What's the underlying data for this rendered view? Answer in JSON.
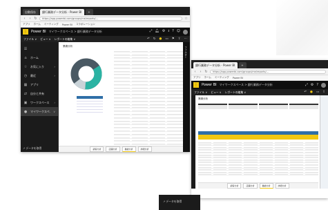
{
  "window1": {
    "tabs": [
      "自動保存",
      "銀行業務データ分析 - Power BI",
      "+"
    ],
    "url": "https://app.powerbi.com/groups/me/reports/...",
    "bookmarks": [
      "アプリ",
      "ホーム",
      "ミーティング",
      "Power BI",
      "コラボレーション"
    ],
    "app_name": "Power BI",
    "breadcrumb": "マイワークスペース > 銀行業務データ分析",
    "menu": [
      "ファイル ∨",
      "ビュー ∨",
      "レポートの編集 ∨"
    ],
    "sidebar": [
      {
        "icon": "☰",
        "label": "",
        "arrow": ""
      },
      {
        "icon": "⌂",
        "label": "ホーム",
        "arrow": ""
      },
      {
        "icon": "☆",
        "label": "お気に入り",
        "arrow": "›"
      },
      {
        "icon": "◷",
        "label": "最近",
        "arrow": "›"
      },
      {
        "icon": "▦",
        "label": "アプリ",
        "arrow": ""
      },
      {
        "icon": "⇄",
        "label": "自分と共有",
        "arrow": ""
      },
      {
        "icon": "▣",
        "label": "ワークスペース",
        "arrow": "›"
      },
      {
        "icon": "●",
        "label": "マイワークスペ...",
        "arrow": "∨"
      }
    ],
    "sidebar_footer": "↗ データを取得",
    "report_title": "業績分析",
    "filters_label": "フィルター",
    "pages": [
      "顧客分析",
      "店舗分析",
      "業績分析",
      "詳細分析"
    ]
  },
  "window2": {
    "tabs": [
      "銀行業務データ分析 - Power BI",
      "+"
    ],
    "url": "https://app.powerbi.com/groups/me/reports/...",
    "bookmarks": [
      "アプリ",
      "ホーム",
      "ミーティング",
      "Power BI"
    ],
    "app_name": "Power BI",
    "breadcrumb": "マイワークスペース > 銀行業務データ分析",
    "menu": [
      "ファイル ∨",
      "ビュー ∨",
      "レポートの編集 ∨"
    ],
    "report_title": "業績分析",
    "pages": [
      "顧客分析",
      "店舗分析",
      "業績分析",
      "詳細分析"
    ],
    "sidebar_footer": "↗ データを取得"
  },
  "colors": {
    "accent": "#f2c811",
    "teal": "#2bb3a3",
    "slate": "#4a5963",
    "blue": "#2f6fa7",
    "dark": "#1b1b1b"
  }
}
